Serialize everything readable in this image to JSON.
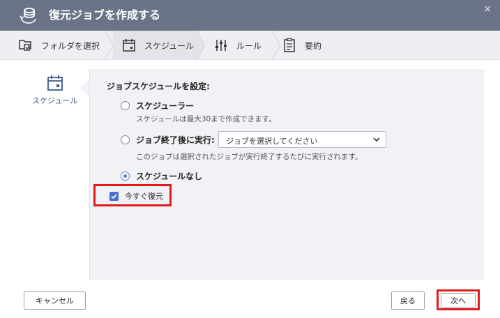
{
  "window": {
    "title": "復元ジョブを作成する",
    "close_glyph": "×"
  },
  "steps": [
    {
      "label": "フォルダを選択",
      "icon": "folder-select-icon"
    },
    {
      "label": "スケジュール",
      "icon": "calendar-icon",
      "active": true
    },
    {
      "label": "ルール",
      "icon": "sliders-icon"
    },
    {
      "label": "要約",
      "icon": "clipboard-icon"
    }
  ],
  "sidebar": {
    "label": "スケジュール",
    "icon": "calendar-icon"
  },
  "schedule": {
    "heading": "ジョブスケジュールを設定:",
    "options": [
      {
        "label": "スケジューラー",
        "description": "スケジュールは最大30まで作成できます。",
        "selected": false
      },
      {
        "label": "ジョブ終了後に実行:",
        "description": "このジョブは選択されたジョブが実行終了するたびに実行されます。",
        "selected": false
      },
      {
        "label": "スケジュールなし",
        "selected": true
      }
    ],
    "job_select": {
      "value": "ジョブを選択してください"
    },
    "restore_now": {
      "label": "今すぐ復元",
      "checked": true
    }
  },
  "footer": {
    "cancel": "キャンセル",
    "back": "戻る",
    "next": "次へ"
  },
  "colors": {
    "titlebar": "#6b7389",
    "accent": "#4a6fd0",
    "highlight": "#e01b1b"
  }
}
